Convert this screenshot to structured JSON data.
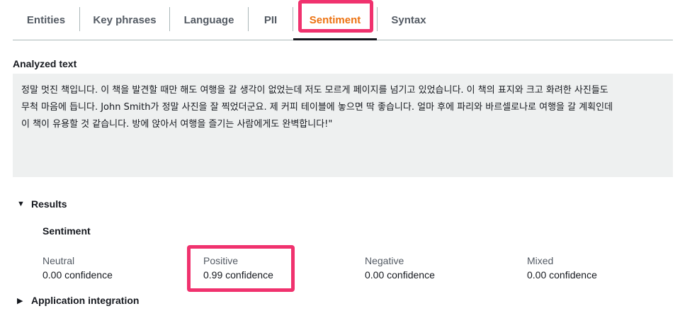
{
  "tabs": [
    {
      "label": "Entities"
    },
    {
      "label": "Key phrases"
    },
    {
      "label": "Language"
    },
    {
      "label": "PII"
    },
    {
      "label": "Sentiment",
      "active": true
    },
    {
      "label": "Syntax"
    }
  ],
  "analyzed_text": {
    "label": "Analyzed text",
    "lines": [
      "정말 멋진 책입니다. 이 책을 발견할 때만 해도 여행을 갈 생각이 없었는데 저도 모르게 페이지를 넘기고 있었습니다. 이 책의 표지와 크고 화려한 사진들도",
      "무척 마음에 듭니다. John Smith가 정말 사진을 잘 찍었더군요. 제 커피 테이블에 놓으면 딱 좋습니다. 얼마 후에 파리와 바르셀로나로 여행을 갈 계획인데",
      "이 책이 유용할 것 같습니다. 방에 앉아서 여행을 즐기는 사람에게도 완벽합니다!\""
    ]
  },
  "results": {
    "label": "Results",
    "sentiment_title": "Sentiment",
    "metrics": [
      {
        "label": "Neutral",
        "value": "0.00 confidence"
      },
      {
        "label": "Positive",
        "value": "0.99 confidence"
      },
      {
        "label": "Negative",
        "value": "0.00 confidence"
      },
      {
        "label": "Mixed",
        "value": "0.00 confidence"
      }
    ]
  },
  "app_integration": {
    "label": "Application integration"
  },
  "colors": {
    "active_tab": "#ec7211",
    "highlight": "#f0326e",
    "text_bg": "#eef0f0"
  },
  "icons": {
    "expanded": "caret-down-icon",
    "collapsed": "caret-right-icon"
  }
}
